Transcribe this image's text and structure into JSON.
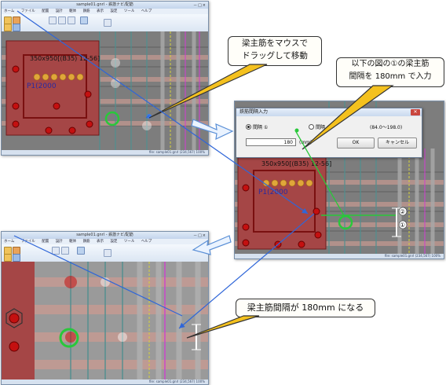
{
  "top_window": {
    "title": "sample01.gnrl - 鉄筋ナビ/配筋",
    "menu": [
      "ホーム",
      "ファイル",
      "配置",
      "設計",
      "躯体",
      "鉄筋",
      "表示",
      "設定",
      "ツール",
      "ヘルプ"
    ],
    "status": "file: sample01.gnrl  (234,567)  100%",
    "plan_label": "P1(2000",
    "beam_label": "350x950[(B35) 12-56]"
  },
  "dialog": {
    "title": "鉄筋間隔入力",
    "radio1_label": "間隔 ①",
    "radio2_label": "間隔 ②",
    "range": "(84.0～198.0)",
    "value": "180",
    "unit": "(mm)",
    "ok_label": "OK",
    "cancel_label": "キャンセル"
  },
  "middle_window": {
    "beam_label": "350x950[(B35) 12-56]",
    "plan_label": "P1(2000",
    "status": "file: sample01.gnrl  (234,567)  100%"
  },
  "bottom_window": {
    "title": "sample01.gnrl - 鉄筋ナビ/配筋",
    "menu": [
      "ホーム",
      "ファイル",
      "配置",
      "設計",
      "躯体",
      "鉄筋",
      "表示",
      "設定",
      "ツール",
      "ヘルプ"
    ],
    "status": "file: sample01.gnrl  (234,567)  100%"
  },
  "callouts": {
    "drag": "梁主筋をマウスで\nドラッグして移動",
    "input": "以下の図の①の梁主筋\n間隔を 180mm で入力",
    "result": "梁主筋間隔が 180mm になる"
  },
  "markers": {
    "circle1": "①",
    "circle2": "②"
  },
  "colors": {
    "arrow": "#2f66d8",
    "callout_fill": "#f4c11e",
    "green_marker": "#29c83a",
    "slab": "#b25f5f"
  }
}
